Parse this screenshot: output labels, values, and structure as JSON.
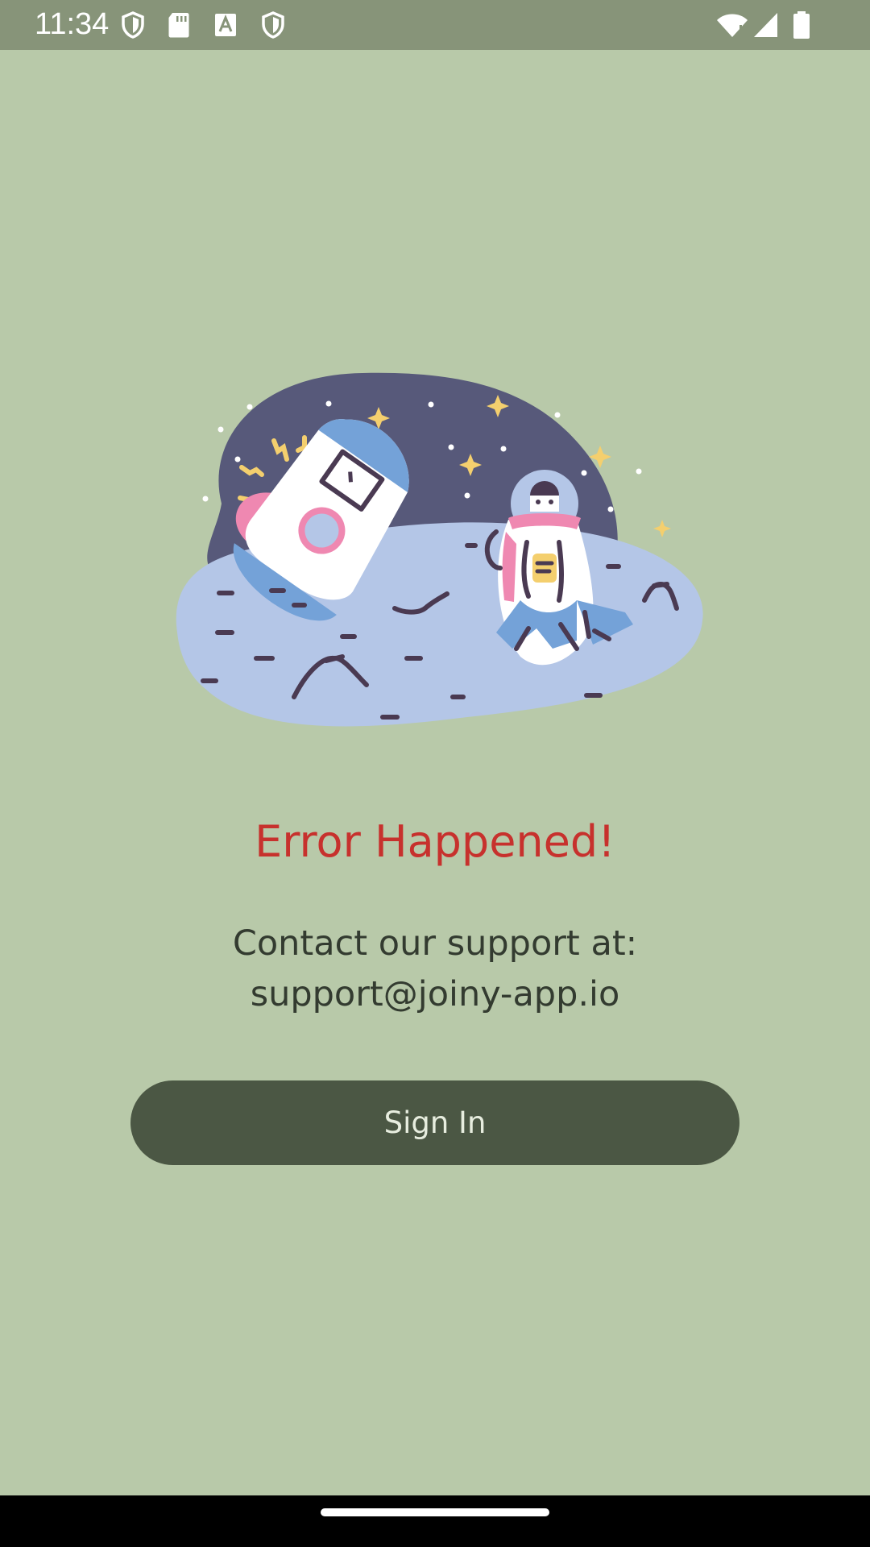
{
  "status_bar": {
    "time": "11:34",
    "left_icons": [
      "shield-icon",
      "sd-card-icon",
      "font-a-icon",
      "shield-icon"
    ],
    "right_icons": [
      "wifi-icon",
      "signal-icon",
      "battery-icon"
    ]
  },
  "illustration": {
    "description_icon": "astronaut-crashed-rocket-illustration",
    "colors": {
      "sky": "#57597a",
      "ground": "#b4c6e7",
      "rocket_pink": "#ef88b1",
      "rocket_blue": "#74a2d8",
      "stars": "#f4cf6e",
      "outline": "#4a3a52"
    }
  },
  "error": {
    "title": "Error Happened!",
    "support_line1": "Contact our support at:",
    "support_line2": "support@joiny-app.io"
  },
  "actions": {
    "sign_in_label": "Sign In"
  },
  "theme": {
    "background": "#b8c9a9",
    "accent_error": "#c7312d",
    "button_bg": "#4b5744",
    "button_text": "#e7eddf"
  }
}
